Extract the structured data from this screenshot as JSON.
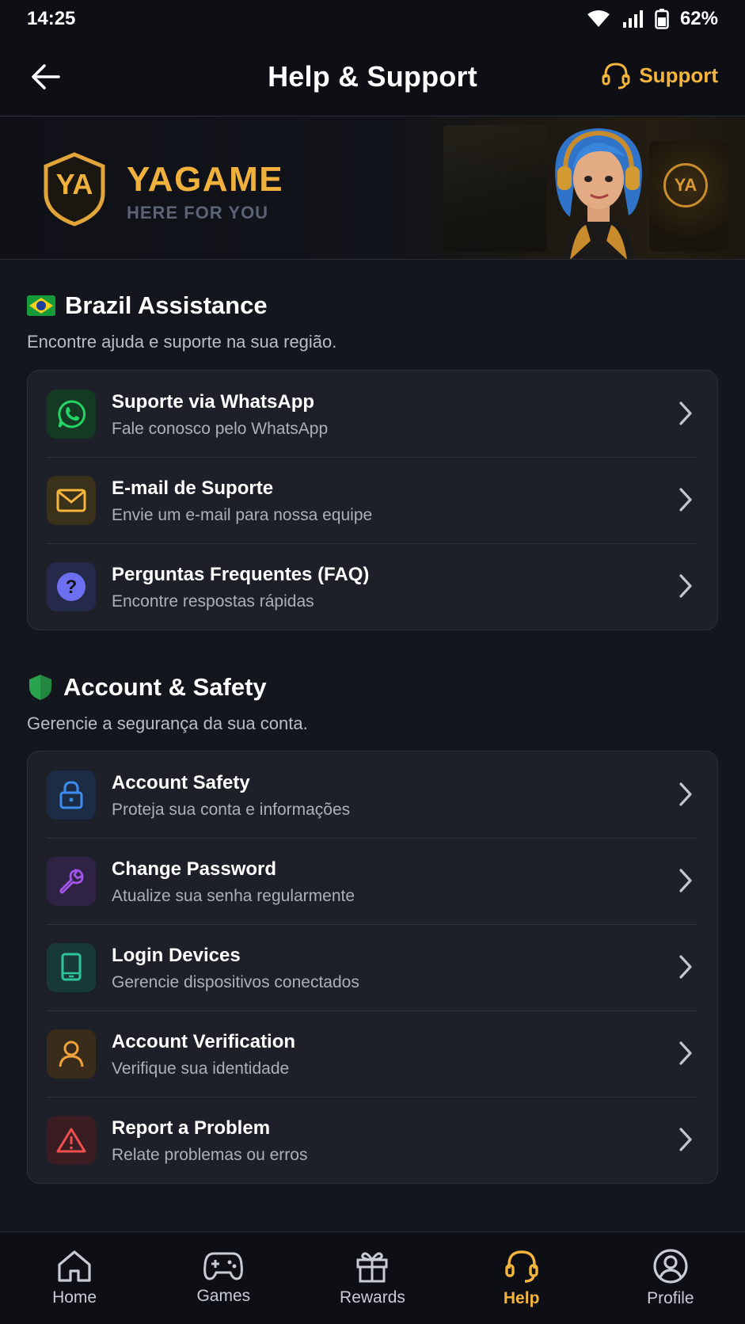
{
  "status_bar": {
    "time": "14:25",
    "battery": "62%"
  },
  "header": {
    "title": "Help & Support",
    "support_label": "Support"
  },
  "banner": {
    "logo_text": "YA",
    "brand_name": "YAGAME",
    "tagline": "HERE FOR YOU",
    "coin_text": "YA"
  },
  "sections": [
    {
      "title": "Brazil Assistance",
      "subtitle": "Encontre ajuda e suporte na sua região.",
      "icon": "brazil-flag-icon",
      "items": [
        {
          "title": "Suporte via WhatsApp",
          "subtitle": "Fale conosco pelo WhatsApp",
          "icon": "whatsapp-icon",
          "color": "#25d366"
        },
        {
          "title": "E-mail de Suporte",
          "subtitle": "Envie um e-mail para nossa equipe",
          "icon": "mail-icon",
          "color": "#f5b53d"
        },
        {
          "title": "Perguntas Frequentes (FAQ)",
          "subtitle": "Encontre respostas rápidas",
          "icon": "question-icon",
          "color": "#6b6ff0"
        }
      ]
    },
    {
      "title": "Account & Safety",
      "subtitle": "Gerencie a segurança da sua conta.",
      "icon": "shield-icon",
      "items": [
        {
          "title": "Account Safety",
          "subtitle": "Proteja sua conta e informações",
          "icon": "lock-icon",
          "color": "#3b8df0"
        },
        {
          "title": "Change Password",
          "subtitle": "Atualize sua senha regularmente",
          "icon": "wrench-icon",
          "color": "#a256e8"
        },
        {
          "title": "Login Devices",
          "subtitle": "Gerencie dispositivos conectados",
          "icon": "device-icon",
          "color": "#2ec4a0"
        },
        {
          "title": "Account Verification",
          "subtitle": "Verifique sua identidade",
          "icon": "user-icon",
          "color": "#f0a33d"
        },
        {
          "title": "Report a Problem",
          "subtitle": "Relate problemas ou erros",
          "icon": "alert-icon",
          "color": "#ef4f4f"
        }
      ]
    }
  ],
  "nav": [
    {
      "label": "Home",
      "icon": "home-icon"
    },
    {
      "label": "Games",
      "icon": "gamepad-icon"
    },
    {
      "label": "Rewards",
      "icon": "gift-icon"
    },
    {
      "label": "Help",
      "icon": "headset-icon",
      "active": true
    },
    {
      "label": "Profile",
      "icon": "profile-icon"
    }
  ],
  "colors": {
    "accent": "#f5b53d",
    "background": "#14161d",
    "card": "#1d2029"
  }
}
